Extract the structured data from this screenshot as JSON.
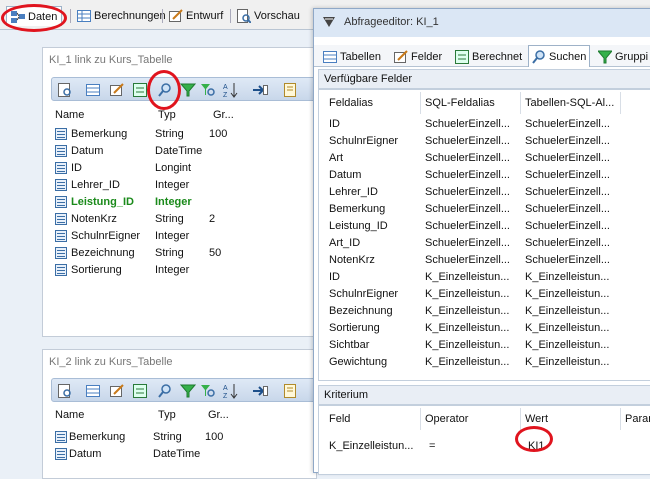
{
  "top_tabs": [
    {
      "label": "Daten",
      "icon": "data-icon"
    },
    {
      "label": "Berechnungen",
      "icon": "table-icon"
    },
    {
      "label": "Entwurf",
      "icon": "pencil-icon"
    },
    {
      "label": "Vorschau",
      "icon": "preview-icon"
    }
  ],
  "panel1": {
    "title": "KI_1 link zu Kurs_Tabelle",
    "headers": [
      "Name",
      "Typ",
      "Gr..."
    ],
    "rows": [
      {
        "name": "Bemerkung",
        "type": "String",
        "size": "100",
        "bold": false
      },
      {
        "name": "Datum",
        "type": "DateTime",
        "size": "",
        "bold": false
      },
      {
        "name": "ID",
        "type": "Longint",
        "size": "",
        "bold": false
      },
      {
        "name": "Lehrer_ID",
        "type": "Integer",
        "size": "",
        "bold": false
      },
      {
        "name": "Leistung_ID",
        "type": "Integer",
        "size": "",
        "bold": true
      },
      {
        "name": "NotenKrz",
        "type": "String",
        "size": "2",
        "bold": false
      },
      {
        "name": "SchulnrEigner",
        "type": "Integer",
        "size": "",
        "bold": false
      },
      {
        "name": "Bezeichnung",
        "type": "String",
        "size": "50",
        "bold": false
      },
      {
        "name": "Sortierung",
        "type": "Integer",
        "size": "",
        "bold": false
      }
    ]
  },
  "panel2": {
    "title": "KI_2 link zu Kurs_Tabelle",
    "headers": [
      "Name",
      "Typ",
      "Gr..."
    ],
    "rows": [
      {
        "name": "Bemerkung",
        "type": "String",
        "size": "100"
      },
      {
        "name": "Datum",
        "type": "DateTime",
        "size": ""
      }
    ]
  },
  "dialog": {
    "title": "Abfrageeditor: KI_1",
    "tabs": [
      {
        "label": "Tabellen",
        "icon": "table-icon"
      },
      {
        "label": "Felder",
        "icon": "pencil-icon"
      },
      {
        "label": "Berechnet",
        "icon": "calc-icon"
      },
      {
        "label": "Suchen",
        "icon": "search-icon"
      },
      {
        "label": "Gruppi",
        "icon": "filter-icon"
      }
    ],
    "fields_section": "Verfügbare Felder",
    "fields_headers": [
      "Feldalias",
      "SQL-Feldalias",
      "Tabellen-SQL-Al..."
    ],
    "fields_rows": [
      [
        "ID",
        "SchuelerEinzell...",
        "SchuelerEinzell..."
      ],
      [
        "SchulnrEigner",
        "SchuelerEinzell...",
        "SchuelerEinzell..."
      ],
      [
        "Art",
        "SchuelerEinzell...",
        "SchuelerEinzell..."
      ],
      [
        "Datum",
        "SchuelerEinzell...",
        "SchuelerEinzell..."
      ],
      [
        "Lehrer_ID",
        "SchuelerEinzell...",
        "SchuelerEinzell..."
      ],
      [
        "Bemerkung",
        "SchuelerEinzell...",
        "SchuelerEinzell..."
      ],
      [
        "Leistung_ID",
        "SchuelerEinzell...",
        "SchuelerEinzell..."
      ],
      [
        "Art_ID",
        "SchuelerEinzell...",
        "SchuelerEinzell..."
      ],
      [
        "NotenKrz",
        "SchuelerEinzell...",
        "SchuelerEinzell..."
      ],
      [
        "ID",
        "K_Einzelleistun...",
        "K_Einzelleistun..."
      ],
      [
        "SchulnrEigner",
        "K_Einzelleistun...",
        "K_Einzelleistun..."
      ],
      [
        "Bezeichnung",
        "K_Einzelleistun...",
        "K_Einzelleistun..."
      ],
      [
        "Sortierung",
        "K_Einzelleistun...",
        "K_Einzelleistun..."
      ],
      [
        "Sichtbar",
        "K_Einzelleistun...",
        "K_Einzelleistun..."
      ],
      [
        "Gewichtung",
        "K_Einzelleistun...",
        "K_Einzelleistun..."
      ]
    ],
    "criteria_section": "Kriterium",
    "criteria_headers": [
      "Feld",
      "Operator",
      "Wert",
      "Param"
    ],
    "criteria_rows": [
      [
        "K_Einzelleistun...",
        "=",
        "KI1",
        ""
      ]
    ]
  },
  "colors": {
    "accent_red": "#e0141e",
    "bold_green": "#1a8a1a"
  }
}
